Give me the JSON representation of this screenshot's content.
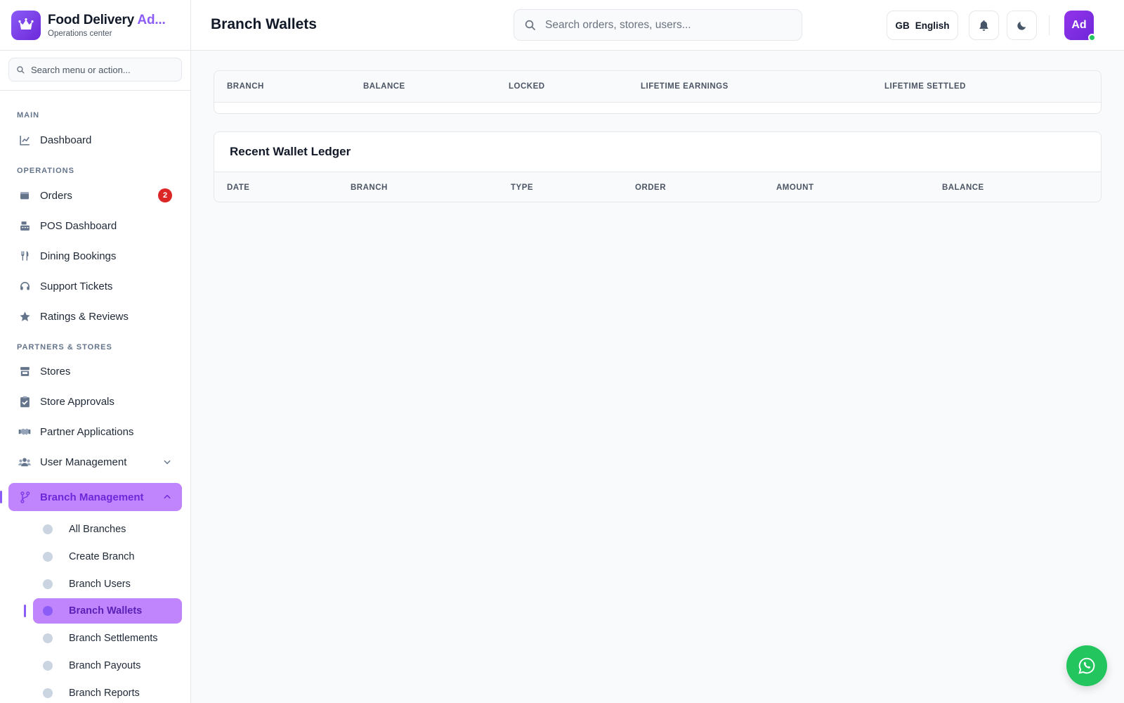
{
  "brand": {
    "title_main": "Food Delivery ",
    "title_accent": "Ad...",
    "subtitle": "Operations center",
    "logo_icon": "crown-icon",
    "accent_color": "#8b5cf6"
  },
  "sidebar": {
    "search_placeholder": "Search menu or action...",
    "sections": {
      "main": "MAIN",
      "operations": "OPERATIONS",
      "partners": "PARTNERS & STORES"
    },
    "items": {
      "dashboard": "Dashboard",
      "orders": "Orders",
      "orders_badge": "2",
      "pos": "POS Dashboard",
      "dining": "Dining Bookings",
      "support": "Support Tickets",
      "ratings": "Ratings & Reviews",
      "stores": "Stores",
      "store_approvals": "Store Approvals",
      "partner_apps": "Partner Applications",
      "user_mgmt": "User Management",
      "branch_mgmt": "Branch Management"
    },
    "branch_sub": [
      "All Branches",
      "Create Branch",
      "Branch Users",
      "Branch Wallets",
      "Branch Settlements",
      "Branch Payouts",
      "Branch Reports"
    ],
    "active_sub": "Branch Wallets"
  },
  "header": {
    "title": "Branch Wallets",
    "search_placeholder": "Search orders, stores, users...",
    "lang_code": "GB",
    "lang_label": "English",
    "avatar_initials": "Ad"
  },
  "wallets_table": {
    "columns": [
      "BRANCH",
      "BALANCE",
      "LOCKED",
      "LIFETIME EARNINGS",
      "LIFETIME SETTLED"
    ],
    "rows": []
  },
  "ledger": {
    "title": "Recent Wallet Ledger",
    "columns": [
      "DATE",
      "BRANCH",
      "TYPE",
      "ORDER",
      "AMOUNT",
      "BALANCE"
    ],
    "rows": []
  },
  "colors": {
    "active_bg": "#c084fc",
    "badge": "#dc2626",
    "whatsapp": "#22c55e"
  }
}
